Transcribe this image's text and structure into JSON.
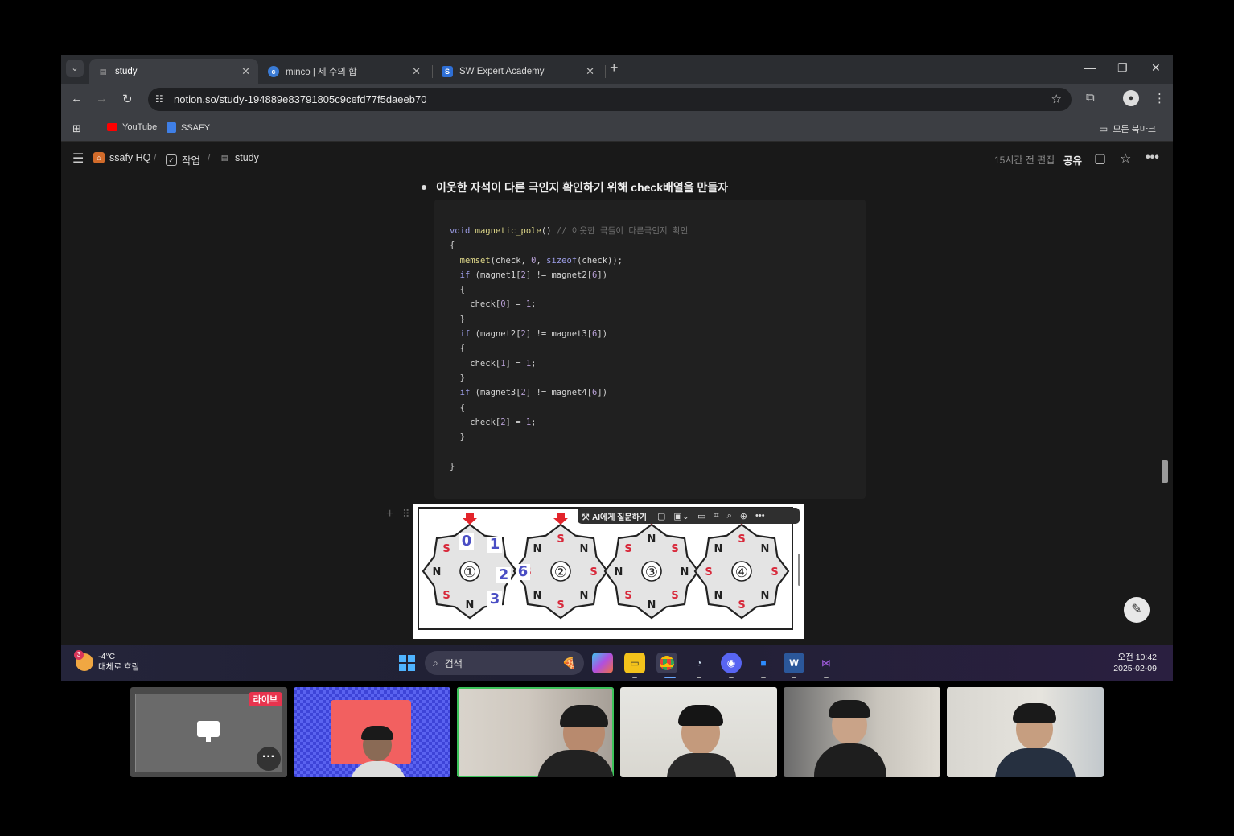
{
  "browser": {
    "tabs": [
      {
        "title": "study",
        "active": true
      },
      {
        "title": "minco | 세 수의 합",
        "active": false
      },
      {
        "title": "SW Expert Academy",
        "active": false
      }
    ],
    "url": "notion.so/study-194889e83791805c9cefd77f5daeeb70",
    "bookmarks": [
      {
        "label": "YouTube",
        "color": "#ff0000"
      },
      {
        "label": "SSAFY",
        "color": "#3f7fe6"
      }
    ],
    "all_bookmarks": "모든 북마크"
  },
  "notion": {
    "breadcrumbs": [
      "ssafy HQ",
      "작업",
      "study"
    ],
    "edited": "15시간 전 편집",
    "share": "공유",
    "bullet_text": "이웃한 자석이 다른 극인지 확인하기 위해 check배열을 만들자",
    "code_comment": "// 이웃한 극들이 다른극인지 확인",
    "image_toolbar": {
      "ask_ai": "AI에게 질문하기"
    },
    "diagram": {
      "gear_numbers": [
        "①",
        "②",
        "③",
        "④"
      ],
      "index_labels": [
        "0",
        "1",
        "2",
        "3",
        "6"
      ],
      "pole_n": "N",
      "pole_s": "S"
    }
  },
  "taskbar": {
    "weather_temp": "-4°C",
    "weather_desc": "대체로 흐림",
    "weather_badge": "3",
    "search_placeholder": "검색",
    "time": "오전 10:42",
    "date": "2025-02-09"
  },
  "meeting": {
    "live_badge": "라이브"
  },
  "colors": {
    "notion_bg": "#191919",
    "code_bg": "#202020",
    "speaking_outline": "#3cc35a",
    "live_badge": "#e8344e"
  }
}
